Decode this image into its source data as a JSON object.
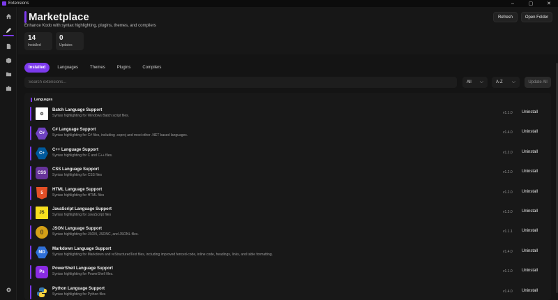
{
  "window": {
    "title": "Extensions",
    "controls": [
      "–",
      "▢",
      "✕"
    ]
  },
  "header": {
    "title": "Marketplace",
    "subtitle": "Enhance Kodo with syntax highlighting, plugins, themes, and compilers",
    "stats": [
      {
        "value": "14",
        "label": "Installed"
      },
      {
        "value": "0",
        "label": "Updates"
      }
    ],
    "refresh_label": "Refresh",
    "open_folder_label": "Open Folder"
  },
  "tabs": [
    {
      "label": "Installed",
      "active": true
    },
    {
      "label": "Languages",
      "active": false
    },
    {
      "label": "Themes",
      "active": false
    },
    {
      "label": "Plugins",
      "active": false
    },
    {
      "label": "Compilers",
      "active": false
    }
  ],
  "filters": {
    "search_placeholder": "Search extensions...",
    "category_value": "All",
    "sort_value": "A-Z",
    "update_all_label": "Update All"
  },
  "section": {
    "title": "Languages"
  },
  "extensions": [
    {
      "name": "Batch Language Support",
      "description": "Syntax highlighting for Windows Batch script files.",
      "version": "v1.1.0",
      "action": "Uninstall",
      "icon": "batch-icon",
      "badge": "⚙",
      "icon_bg": "#ffffff",
      "icon_fg": "#333333",
      "icon_shape": "square"
    },
    {
      "name": "C# Language Support",
      "description": "Syntax highlighting for C# files, including .csproj and most other .NET based languages.",
      "version": "v1.4.0",
      "action": "Uninstall",
      "icon": "csharp-icon",
      "badge": "C#",
      "icon_bg": "#6f42c1",
      "icon_fg": "#ffffff",
      "icon_shape": "hex"
    },
    {
      "name": "C++ Language Support",
      "description": "Syntax highlighting for C and C++ files.",
      "version": "v1.2.0",
      "action": "Uninstall",
      "icon": "cpp-icon",
      "badge": "C+",
      "icon_bg": "#00599c",
      "icon_fg": "#ffffff",
      "icon_shape": "hex"
    },
    {
      "name": "CSS Language Support",
      "description": "Syntax highlighting for CSS files",
      "version": "v1.2.0",
      "action": "Uninstall",
      "icon": "css-icon",
      "badge": "CSS",
      "icon_bg": "#663399",
      "icon_fg": "#ffffff",
      "icon_shape": "rounded"
    },
    {
      "name": "HTML Language Support",
      "description": "Syntax highlighting for HTML files",
      "version": "v1.2.0",
      "action": "Uninstall",
      "icon": "html-icon",
      "badge": "5",
      "icon_bg": "#e34f26",
      "icon_fg": "#ffffff",
      "icon_shape": "shield"
    },
    {
      "name": "JavaScript Language Support",
      "description": "Syntax highlighting for JavaScript files",
      "version": "v1.3.0",
      "action": "Uninstall",
      "icon": "javascript-icon",
      "badge": "JS",
      "icon_bg": "#f7df1e",
      "icon_fg": "#222222",
      "icon_shape": "square"
    },
    {
      "name": "JSON Language Support",
      "description": "Syntax highlighting for JSON, JSONC, and JSONL files.",
      "version": "v1.1.1",
      "action": "Uninstall",
      "icon": "json-icon",
      "badge": "{}",
      "icon_bg": "#d4a017",
      "icon_fg": "#222222",
      "icon_shape": "circle"
    },
    {
      "name": "Markdown Language Support",
      "description": "Syntax highlighting for Markdown and reStructuredText files, including improved fenced-code, inline code, headings, links, and table formatting.",
      "version": "v1.4.0",
      "action": "Uninstall",
      "icon": "markdown-icon",
      "badge": "MD",
      "icon_bg": "#2f6fd6",
      "icon_fg": "#ffffff",
      "icon_shape": "hex"
    },
    {
      "name": "PowerShell Language Support",
      "description": "Syntax highlighting for PowerShell files.",
      "version": "v1.1.0",
      "action": "Uninstall",
      "icon": "powershell-icon",
      "badge": "Ps",
      "icon_bg": "#8a2be2",
      "icon_fg": "#ffffff",
      "icon_shape": "rounded"
    },
    {
      "name": "Python Language Support",
      "description": "Syntax highlighting for Python files",
      "version": "v1.4.0",
      "action": "Uninstall",
      "icon": "python-icon",
      "badge": "",
      "icon_bg": "#3776ab",
      "icon_fg": "#ffd43b",
      "icon_shape": "python"
    }
  ],
  "colors": {
    "accent": "#7c3aed",
    "background": "#121212",
    "panel": "#181818"
  },
  "rail_icons": [
    "home-icon",
    "pen-icon",
    "document-icon",
    "package-icon",
    "folder-icon",
    "puzzle-icon",
    "gear-icon"
  ]
}
